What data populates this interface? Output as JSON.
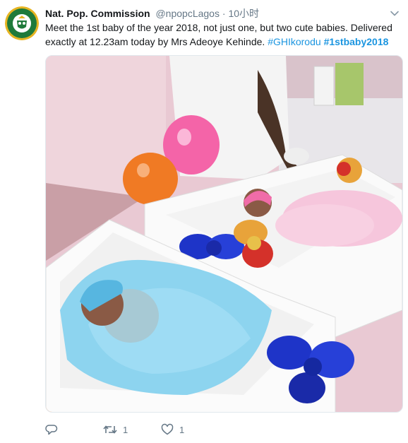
{
  "tweet": {
    "author_name": "Nat. Pop. Commission",
    "handle": "@npopcLagos",
    "separator": "·",
    "timestamp": "10小时",
    "text_main": "Meet the 1st baby of the year 2018, not just one, but two cute babies. Delivered exactly at 12.23am today by Mrs Adeoye Kehinde.",
    "hashtag_1": "#GHIkorodu",
    "hashtag_2": "#1stbaby2018",
    "avatar_logo_text": "NATIONAL POPULATION COMMISSION"
  },
  "actions": {
    "reply_icon": "reply-icon",
    "retweet_icon": "retweet-icon",
    "retweet_count": "1",
    "like_icon": "heart-icon",
    "like_count": "1"
  },
  "colors": {
    "link": "#1b95e0",
    "secondary": "#657786",
    "primary_text": "#14171a",
    "avatar_green": "#1f7a3a",
    "avatar_gold": "#e6b422"
  }
}
